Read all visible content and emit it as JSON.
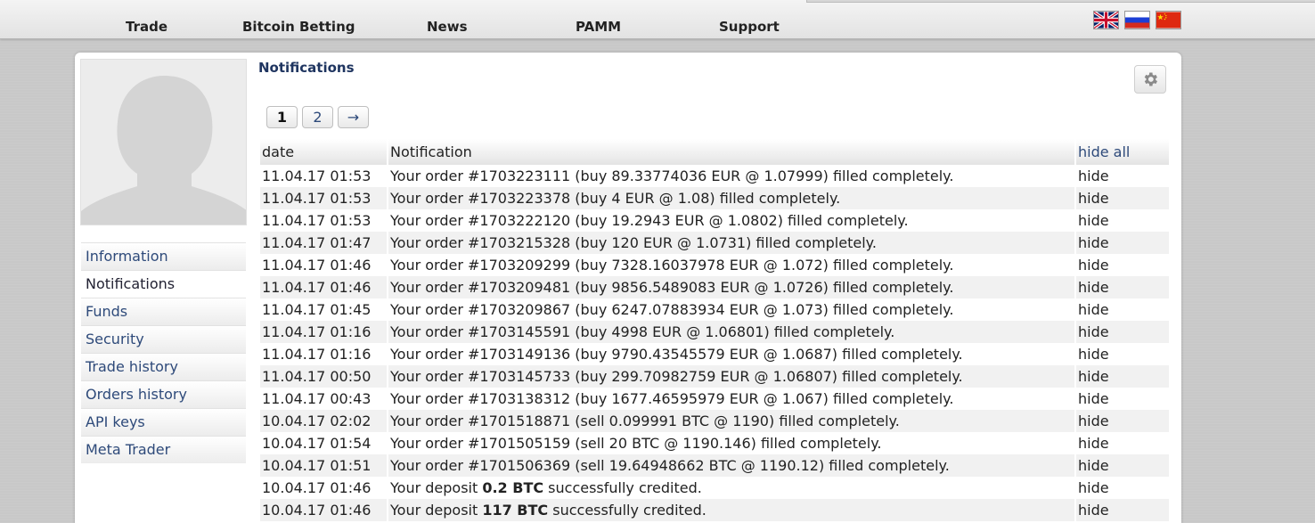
{
  "nav": {
    "items": [
      "Trade",
      "Bitcoin Betting",
      "News",
      "PAMM",
      "Support"
    ]
  },
  "flags": [
    {
      "name": "uk-flag",
      "label": "English"
    },
    {
      "name": "russia-flag",
      "label": "Русский"
    },
    {
      "name": "china-flag",
      "label": "中文"
    }
  ],
  "sidebar": {
    "items": [
      "Information",
      "Notifications",
      "Funds",
      "Security",
      "Trade history",
      "Orders history",
      "API keys",
      "Meta Trader"
    ],
    "active_index": 1
  },
  "page": {
    "title": "Notifications",
    "settings_icon": "gear-icon"
  },
  "pager": {
    "pages": [
      "1",
      "2"
    ],
    "current": "1",
    "next": "→"
  },
  "table": {
    "headers": {
      "date": "date",
      "notification": "Notification",
      "hide_all": "hide all"
    },
    "hide_label": "hide",
    "rows": [
      {
        "date": "11.04.17 01:53",
        "text": "Your order #1703223111 (buy 89.33774036 EUR @ 1.07999) filled completely."
      },
      {
        "date": "11.04.17 01:53",
        "text": "Your order #1703223378 (buy 4 EUR @ 1.08) filled completely."
      },
      {
        "date": "11.04.17 01:53",
        "text": "Your order #1703222120 (buy 19.2943 EUR @ 1.0802) filled completely."
      },
      {
        "date": "11.04.17 01:47",
        "text": "Your order #1703215328 (buy 120 EUR @ 1.0731) filled completely."
      },
      {
        "date": "11.04.17 01:46",
        "text": "Your order #1703209299 (buy 7328.16037978 EUR @ 1.072) filled completely."
      },
      {
        "date": "11.04.17 01:46",
        "text": "Your order #1703209481 (buy 9856.5489083 EUR @ 1.0726) filled completely."
      },
      {
        "date": "11.04.17 01:45",
        "text": "Your order #1703209867 (buy 6247.07883934 EUR @ 1.073) filled completely."
      },
      {
        "date": "11.04.17 01:16",
        "text": "Your order #1703145591 (buy 4998 EUR @ 1.06801) filled completely."
      },
      {
        "date": "11.04.17 01:16",
        "text": "Your order #1703149136 (buy 9790.43545579 EUR @ 1.0687) filled completely."
      },
      {
        "date": "11.04.17 00:50",
        "text": "Your order #1703145733 (buy 299.70982759 EUR @ 1.06807) filled completely."
      },
      {
        "date": "11.04.17 00:43",
        "text": "Your order #1703138312 (buy 1677.46595979 EUR @ 1.067) filled completely."
      },
      {
        "date": "10.04.17 02:02",
        "text": "Your order #1701518871 (sell 0.099991 BTC @ 1190) filled completely."
      },
      {
        "date": "10.04.17 01:54",
        "text": "Your order #1701505159 (sell 20 BTC @ 1190.146) filled completely."
      },
      {
        "date": "10.04.17 01:51",
        "text": "Your order #1701506369 (sell 19.64948662 BTC @ 1190.12) filled completely."
      },
      {
        "date": "10.04.17 01:46",
        "text_before": "Your deposit ",
        "text_bold": "0.2 BTC",
        "text_after": " successfully credited."
      },
      {
        "date": "10.04.17 01:46",
        "text_before": "Your deposit ",
        "text_bold": "117 BTC",
        "text_after": " successfully credited."
      }
    ]
  },
  "colors": {
    "link": "#2e4a7a",
    "title": "#1f3560",
    "background": "#c8c8c8",
    "row_alt": "#f1f1f1"
  }
}
